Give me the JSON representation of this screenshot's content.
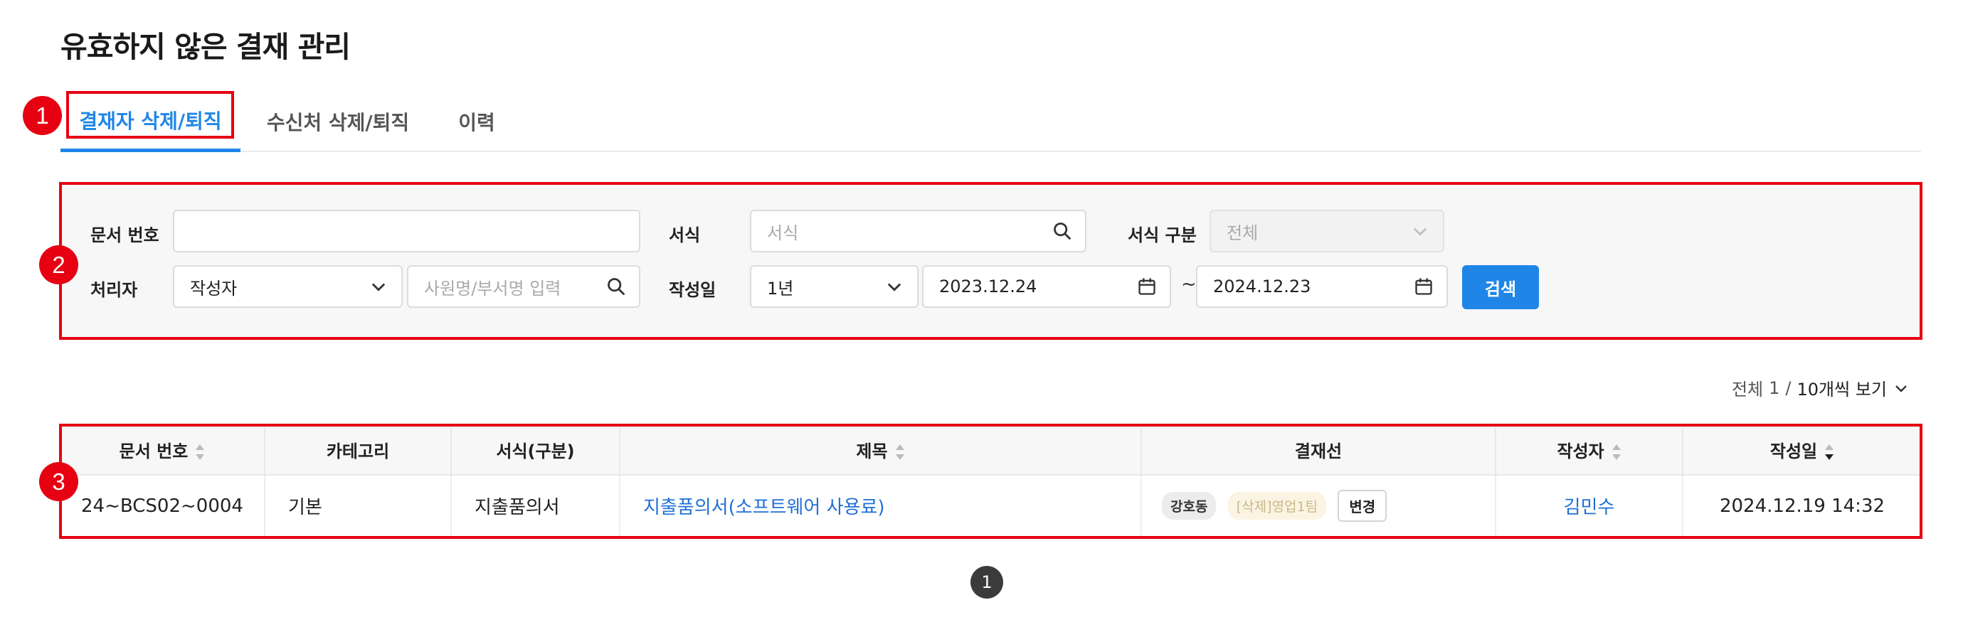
{
  "page_title": "유효하지 않은 결재 관리",
  "tabs": [
    {
      "label": "결재자 삭제/퇴직",
      "active": true
    },
    {
      "label": "수신처 삭제/퇴직",
      "active": false
    },
    {
      "label": "이력",
      "active": false
    }
  ],
  "callouts": [
    "1",
    "2",
    "3"
  ],
  "search": {
    "doc_number_label": "문서 번호",
    "doc_number_value": "",
    "form_label": "서식",
    "form_placeholder": "서식",
    "form_type_label": "서식 구분",
    "form_type_value": "전체",
    "handler_label": "처리자",
    "handler_select": "작성자",
    "handler_placeholder": "사원명/부서명 입력",
    "date_label": "작성일",
    "period_select": "1년",
    "date_from": "2023.12.24",
    "date_separator": "~",
    "date_to": "2024.12.23",
    "search_button": "검색"
  },
  "page_size": {
    "total_label": "전체",
    "total_count": "1",
    "separator": "/",
    "per_page": "10개씩 보기"
  },
  "table": {
    "columns": [
      "문서 번호",
      "카테고리",
      "서식(구분)",
      "제목",
      "결재선",
      "작성자",
      "작성일"
    ],
    "rows": [
      {
        "doc_number": "24~BCS02~0004",
        "category": "기본",
        "form": "지출품의서",
        "title": "지출품의서(소프트웨어 사용료)",
        "approvers": [
          "강호동",
          "[삭제]영업1팀"
        ],
        "change_label": "변경",
        "author": "김민수",
        "date": "2024.12.19 14:32"
      }
    ]
  },
  "pagination": {
    "current": "1"
  },
  "colors": {
    "accent": "#1f86e8",
    "highlight": "#e60012",
    "link": "#1f6fd6"
  },
  "icons": [
    "search-icon",
    "chevron-down-icon",
    "calendar-icon",
    "sort-icon"
  ]
}
